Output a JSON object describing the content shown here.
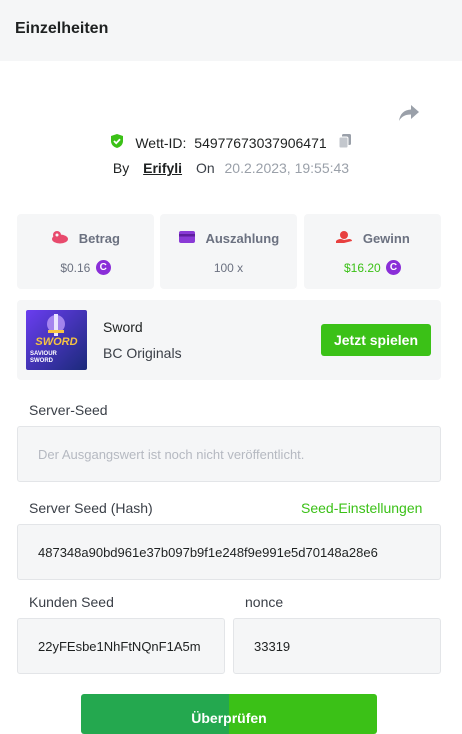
{
  "header": {
    "title": "Einzelheiten"
  },
  "bet": {
    "id_label": "Wett-ID:",
    "id_value": "54977673037906471",
    "by_label": "By",
    "user": "Erifyli",
    "on_label": "On",
    "datetime": "20.2.2023, 19:55:43"
  },
  "stats": {
    "amount": {
      "label": "Betrag",
      "value": "$0.16",
      "icon": "chip-icon",
      "color": "#e84a6d"
    },
    "payout": {
      "label": "Auszahlung",
      "value": "100 x",
      "icon": "card-icon",
      "color": "#8a3ad6"
    },
    "profit": {
      "label": "Gewinn",
      "value": "$16.20",
      "icon": "hand-coin-icon",
      "color": "#e8403f"
    }
  },
  "coin_symbol": "C",
  "game": {
    "name": "Sword",
    "provider": "BC Originals",
    "play_label": "Jetzt spielen",
    "thumb_title": "SWORD",
    "thumb_sub": "SAVIOUR SWORD"
  },
  "seeds": {
    "server_seed_label": "Server-Seed",
    "server_seed_placeholder": "Der Ausgangswert ist noch nicht veröffentlicht.",
    "server_hash_label": "Server Seed (Hash)",
    "seed_settings_label": "Seed-Einstellungen",
    "server_hash_value": "487348a90bd961e37b097b9f1e248f9e991e5d70148a28e6",
    "client_seed_label": "Kunden Seed",
    "client_seed_value": "22yFEsbe1NhFtNQnF1A5m",
    "nonce_label": "nonce",
    "nonce_value": "33319"
  },
  "verify_label": "Überprüfen",
  "colors": {
    "accent": "#3bc117",
    "panel": "#f5f6f7",
    "coin": "#8a2ed8"
  }
}
